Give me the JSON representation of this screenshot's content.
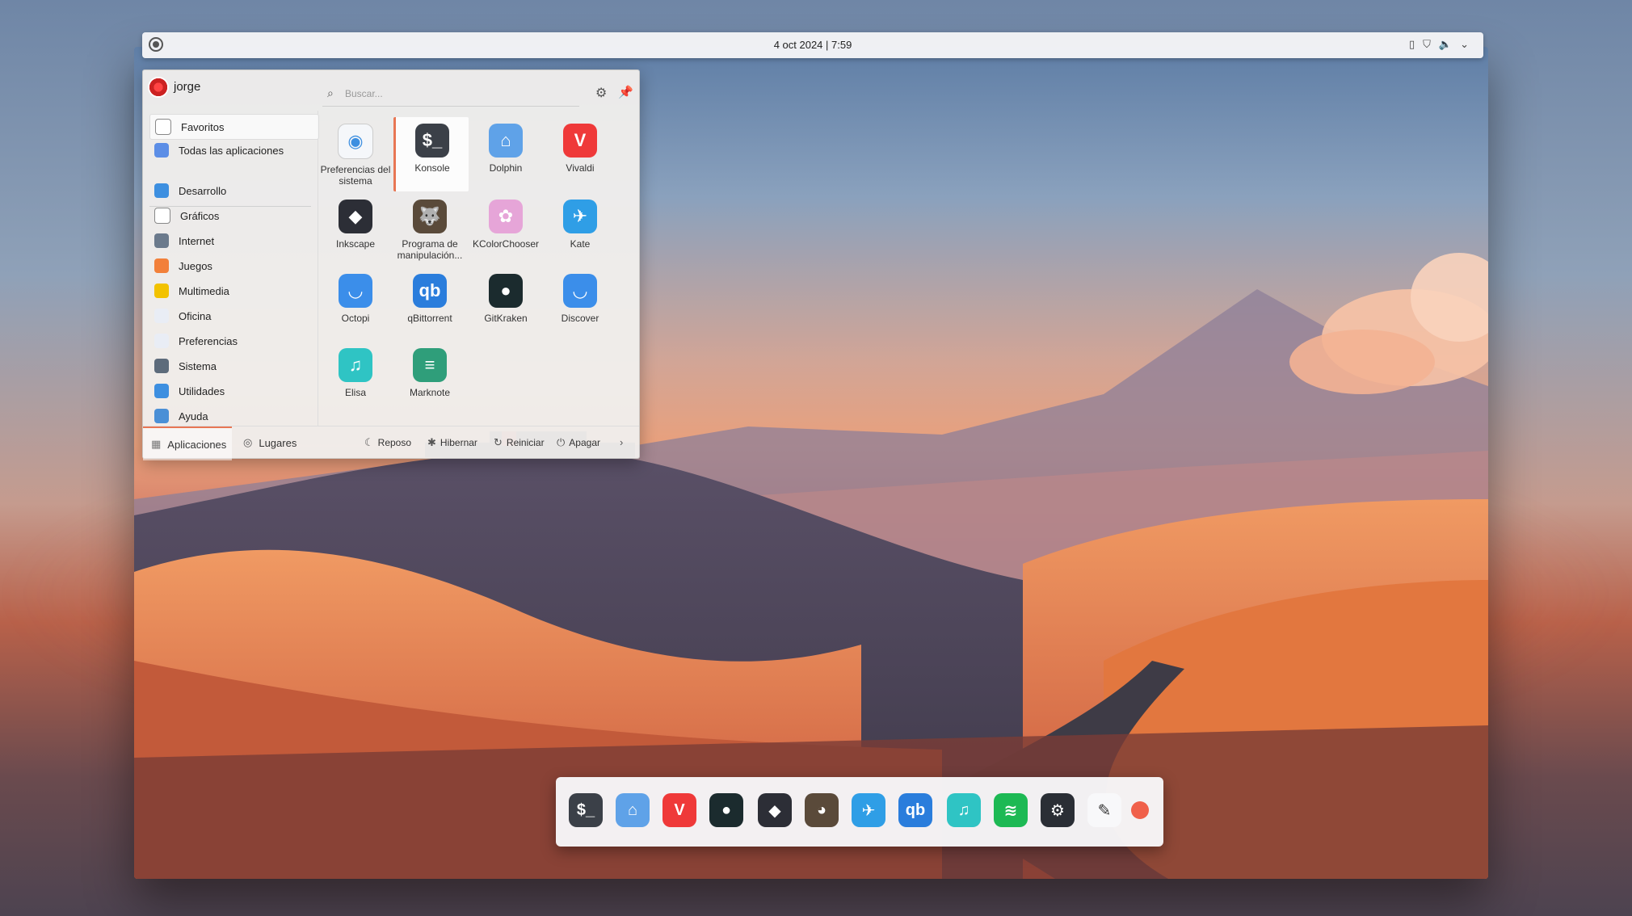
{
  "topbar": {
    "clock": "4 oct 2024 | 7:59",
    "tray": [
      "battery-icon",
      "network-icon",
      "volume-icon",
      "chevron-down-icon"
    ]
  },
  "menu": {
    "user": "jorge",
    "search_placeholder": "Buscar...",
    "sidebar": [
      {
        "label": "Favoritos",
        "icon": "bookmark-icon",
        "color": "#ffffff"
      },
      {
        "label": "Todas las aplicaciones",
        "icon": "apps-icon",
        "color": "#5c8ee6"
      },
      {
        "label": "Desarrollo",
        "icon": "wrench-icon",
        "color": "#3d8fe0"
      },
      {
        "label": "Gráficos",
        "icon": "pen-icon",
        "color": "#ffffff"
      },
      {
        "label": "Internet",
        "icon": "cloud-icon",
        "color": "#6b7a8c"
      },
      {
        "label": "Juegos",
        "icon": "gamepad-icon",
        "color": "#f2803a"
      },
      {
        "label": "Multimedia",
        "icon": "media-icon",
        "color": "#f2c200"
      },
      {
        "label": "Oficina",
        "icon": "document-icon",
        "color": "#e9edf5"
      },
      {
        "label": "Preferencias",
        "icon": "toggle-icon",
        "color": "#e9edf5"
      },
      {
        "label": "Sistema",
        "icon": "gear-icon",
        "color": "#5d6b7b"
      },
      {
        "label": "Utilidades",
        "icon": "utilities-icon",
        "color": "#3d8fe0"
      },
      {
        "label": "Ayuda",
        "icon": "help-icon",
        "color": "#4a8fd6"
      }
    ],
    "apps": [
      {
        "label": "Preferencias del sistema",
        "icon": "settings-toggle-icon",
        "color": "#f5f7fa",
        "glyph": "◉"
      },
      {
        "label": "Konsole",
        "icon": "terminal-icon",
        "color": "#3b4048",
        "glyph": "$_"
      },
      {
        "label": "Dolphin",
        "icon": "folder-icon",
        "color": "#5fa2e8",
        "glyph": "⌂"
      },
      {
        "label": "Vivaldi",
        "icon": "vivaldi-icon",
        "color": "#ef3939",
        "glyph": "V"
      },
      {
        "label": "Inkscape",
        "icon": "inkscape-icon",
        "color": "#2c2e36",
        "glyph": "◆"
      },
      {
        "label": "Programa de manipulación...",
        "icon": "gimp-icon",
        "color": "#5a4a3a",
        "glyph": "🐺"
      },
      {
        "label": "KColorChooser",
        "icon": "color-wheel-icon",
        "color": "#e6a5d8",
        "glyph": "✿"
      },
      {
        "label": "Kate",
        "icon": "kate-icon",
        "color": "#2f9ee6",
        "glyph": "✈"
      },
      {
        "label": "Octopi",
        "icon": "octopi-icon",
        "color": "#3b8eea",
        "glyph": "◡"
      },
      {
        "label": "qBittorrent",
        "icon": "qbittorrent-icon",
        "color": "#2a7ddc",
        "glyph": "qb"
      },
      {
        "label": "GitKraken",
        "icon": "gitkraken-icon",
        "color": "#1b2b2e",
        "glyph": "●"
      },
      {
        "label": "Discover",
        "icon": "discover-icon",
        "color": "#3b8eea",
        "glyph": "◡"
      },
      {
        "label": "Elisa",
        "icon": "music-icon",
        "color": "#2fc4c4",
        "glyph": "♫"
      },
      {
        "label": "Marknote",
        "icon": "marknote-icon",
        "color": "#2f9e7a",
        "glyph": "≡"
      }
    ],
    "footer": {
      "tabs": [
        "Aplicaciones",
        "Lugares"
      ],
      "buttons": [
        "Reposo",
        "Hibernar",
        "Reiniciar",
        "Apagar"
      ]
    }
  },
  "dock": [
    {
      "name": "terminal-icon",
      "color": "#3b4048",
      "glyph": "$_"
    },
    {
      "name": "folder-icon",
      "color": "#5fa2e8",
      "glyph": "⌂"
    },
    {
      "name": "vivaldi-icon",
      "color": "#ef3939",
      "glyph": "V"
    },
    {
      "name": "gitkraken-icon",
      "color": "#1b2b2e",
      "glyph": "●"
    },
    {
      "name": "inkscape-icon",
      "color": "#2c2e36",
      "glyph": "◆"
    },
    {
      "name": "gimp-icon",
      "color": "#5a4a3a",
      "glyph": "◕"
    },
    {
      "name": "kate-icon",
      "color": "#2f9ee6",
      "glyph": "✈"
    },
    {
      "name": "qbittorrent-icon",
      "color": "#2a7ddc",
      "glyph": "qb"
    },
    {
      "name": "music-icon",
      "color": "#2fc4c4",
      "glyph": "♫"
    },
    {
      "name": "spotify-icon",
      "color": "#1db954",
      "glyph": "≋"
    },
    {
      "name": "steam-icon",
      "color": "#2a2e35",
      "glyph": "⚙"
    },
    {
      "name": "color-picker-icon",
      "color": "#f8f8fa",
      "glyph": "✎"
    },
    {
      "name": "record-icon",
      "color": "#f0604a",
      "glyph": ""
    }
  ]
}
